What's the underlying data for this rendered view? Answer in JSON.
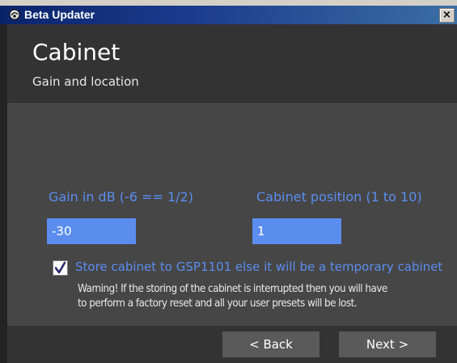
{
  "window": {
    "title": "Beta Updater",
    "close_glyph": "×"
  },
  "header": {
    "title": "Cabinet",
    "subtitle": "Gain and location"
  },
  "form": {
    "gain_label": "Gain in dB (-6 == 1/2)",
    "gain_value": "-30",
    "position_label": "Cabinet position (1 to 10)",
    "position_value": "1",
    "store_checkbox_label": "Store cabinet to GSP1101 else it will be a temporary cabinet",
    "store_checked": true,
    "warning_line1": "Warning!  If the storing of the cabinet is interrupted then you will have",
    "warning_line2": "to perform a factory reset and all your user presets will be lost."
  },
  "footer": {
    "back_label": "< Back",
    "next_label": "Next >"
  },
  "colors": {
    "accent": "#5b8def",
    "header_bg": "#333333",
    "content_bg": "#464646",
    "button_bg": "#5a5a5a"
  }
}
